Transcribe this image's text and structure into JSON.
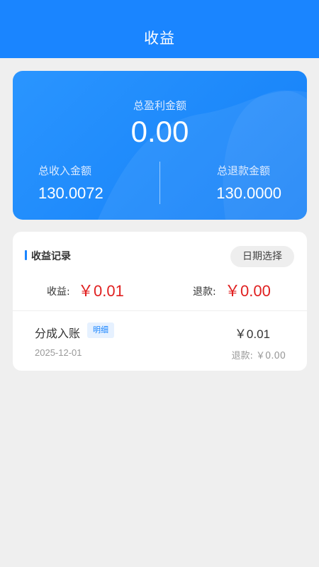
{
  "header": {
    "title": "收益"
  },
  "summary": {
    "profit_label": "总盈利金额",
    "profit_value": "0.00",
    "income_label": "总收入金额",
    "income_value": "130.0072",
    "refund_label": "总退款金额",
    "refund_value": "130.0000"
  },
  "records": {
    "title": "收益记录",
    "date_button_label": "日期选择",
    "income_label": "收益:",
    "income_value": "￥0.01",
    "refund_label": "退款:",
    "refund_value": "￥0.00",
    "items": [
      {
        "title": "分成入账",
        "badge": "明细",
        "date": "2025-12-01",
        "amount": "￥0.01",
        "refund": "退款: ￥0.00"
      }
    ]
  },
  "colors": {
    "brand_blue": "#1a85ff",
    "amount_red": "#e02020",
    "background": "#efefef"
  }
}
